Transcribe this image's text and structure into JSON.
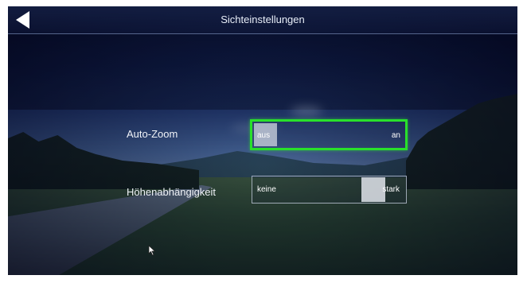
{
  "header": {
    "title": "Sichteinstellungen",
    "back_icon": "back-arrow-icon"
  },
  "settings": {
    "auto_zoom": {
      "label": "Auto-Zoom",
      "off_label": "aus",
      "on_label": "an",
      "value": "aus",
      "focused": true
    },
    "height_dependency": {
      "label": "Höhenabhängigkeit",
      "min_label": "keine",
      "max_label": "stark",
      "level": 0.85
    }
  },
  "colors": {
    "focus_border": "#29e02b",
    "text": "#f0f3f8"
  }
}
